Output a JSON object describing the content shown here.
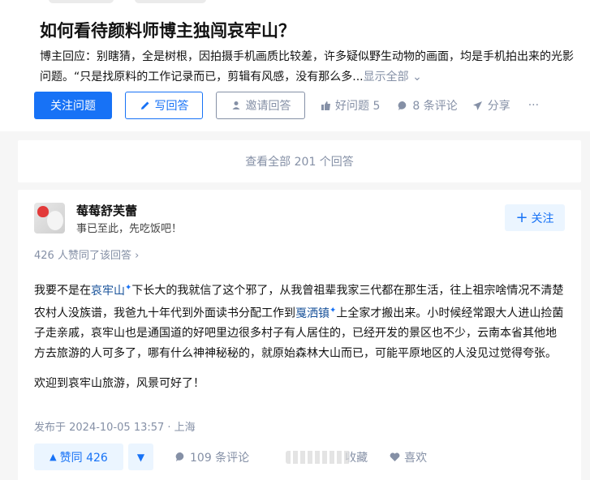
{
  "question": {
    "title": "如何看待颜料师博主独闯哀牢山？",
    "description": "博主回应：别瞎猜，全是树根，因拍摄手机画质比较差，许多疑似野生动物的画面，均是手机拍出来的光影问题。“只是找原料的工作记录而已，剪辑有风感，没有那么多...",
    "show_all": "显示全部",
    "actions": {
      "follow": "关注问题",
      "write": "写回答",
      "invite": "邀请回答",
      "good": "好问题 5",
      "comments": "8 条评论",
      "share": "分享",
      "more": "···"
    }
  },
  "view_all": "查看全部 201 个回答",
  "answer": {
    "author": {
      "name": "莓莓舒芙蕾",
      "bio": "事已至此，先吃饭吧！",
      "follow": "关注"
    },
    "voters": "426 人赞同了该回答",
    "paragraph1": {
      "t1": "我要不是在",
      "link1": "哀牢山",
      "t2": "下长大的我就信了这个邪了，从我曾祖辈我家三代都在那生活，往上祖宗啥情况不清楚农村人没族谱，我爸九十年代到外面读书分配工作到",
      "link2": "戛洒镇",
      "t3": "上全家才搬出来。小时候经常跟大人进山捡菌子走亲戚，哀牢山也是通国道的好吧里边很多村子有人居住的，已经开发的景区也不少，云南本省其他地方去旅游的人可多了，哪有什么神神秘秘的，就原始森林大山而已，可能平原地区的人没见过觉得夸张。"
    },
    "paragraph2": "欢迎到哀牢山旅游，风景可好了！",
    "published": "发布于 2024-10-05 13:57 · 上海",
    "footer": {
      "vote_up": "赞同 426",
      "comments": "109 条评论",
      "collect": "收藏",
      "like": "喜欢"
    }
  },
  "colors": {
    "brand": "#1772f6",
    "muted": "#8590a6",
    "link": "#175199"
  }
}
